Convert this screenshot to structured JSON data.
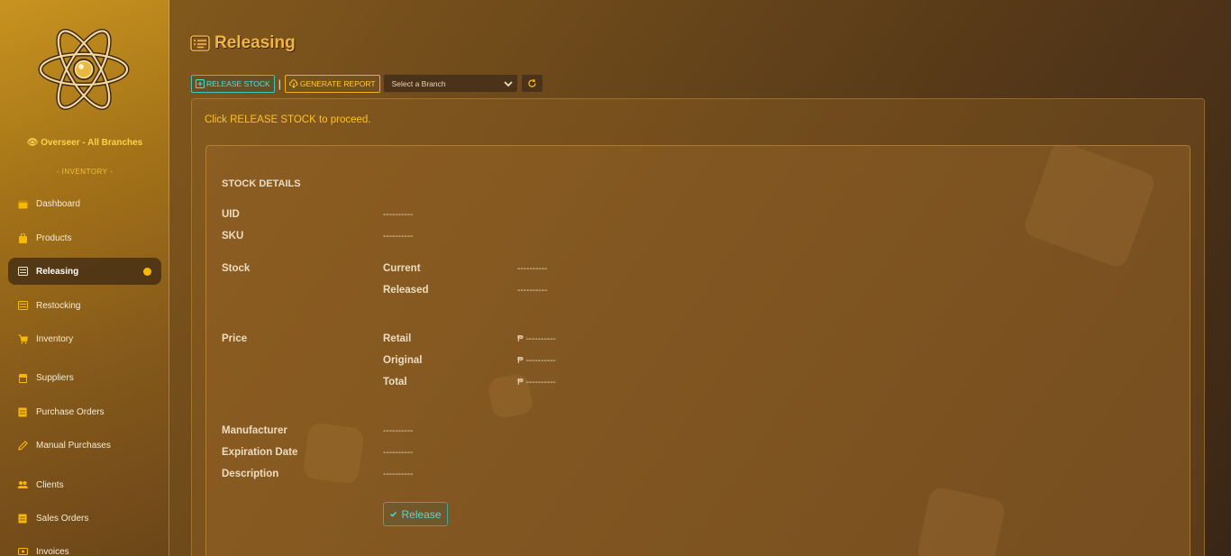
{
  "sidebar": {
    "role": "Overseer - All Branches",
    "section": "- INVENTORY -",
    "items": [
      {
        "label": "Dashboard",
        "icon": "calendar-icon"
      },
      {
        "label": "Products",
        "icon": "bag-icon"
      },
      {
        "label": "Releasing",
        "icon": "list-card-icon",
        "active": true
      },
      {
        "label": "Restocking",
        "icon": "list-icon"
      },
      {
        "label": "Inventory",
        "icon": "cart-icon"
      },
      {
        "label": "Suppliers",
        "icon": "store-icon"
      },
      {
        "label": "Purchase Orders",
        "icon": "receipt-icon"
      },
      {
        "label": "Manual Purchases",
        "icon": "pencil-icon"
      },
      {
        "label": "Clients",
        "icon": "users-icon"
      },
      {
        "label": "Sales Orders",
        "icon": "receipt-icon"
      },
      {
        "label": "Invoices",
        "icon": "money-icon"
      }
    ]
  },
  "page": {
    "title": "Releasing",
    "toolbar": {
      "release_stock": "RELEASE STOCK",
      "separator": "|",
      "generate_report": "GENERATE REPORT",
      "branch_placeholder": "Select a Branch"
    },
    "hint": "Click RELEASE STOCK to proceed."
  },
  "details": {
    "heading": "STOCK DETAILS",
    "uid_label": "UID",
    "uid_value": "----------",
    "sku_label": "SKU",
    "sku_value": "----------",
    "stock_label": "Stock",
    "current_label": "Current",
    "current_value": "----------",
    "released_label": "Released",
    "released_value": "----------",
    "price_label": "Price",
    "retail_label": "Retail",
    "retail_value": "₱ ----------",
    "original_label": "Original",
    "original_value": "₱ ----------",
    "total_label": "Total",
    "total_value": "₱ ----------",
    "manufacturer_label": "Manufacturer",
    "manufacturer_value": "----------",
    "expiration_label": "Expiration Date",
    "expiration_value": "----------",
    "description_label": "Description",
    "description_value": "----------",
    "release_button": "Release"
  },
  "colors": {
    "accent_gold": "#f0b545",
    "accent_teal": "#3ec6c0",
    "active_dot": "#f6b800"
  }
}
